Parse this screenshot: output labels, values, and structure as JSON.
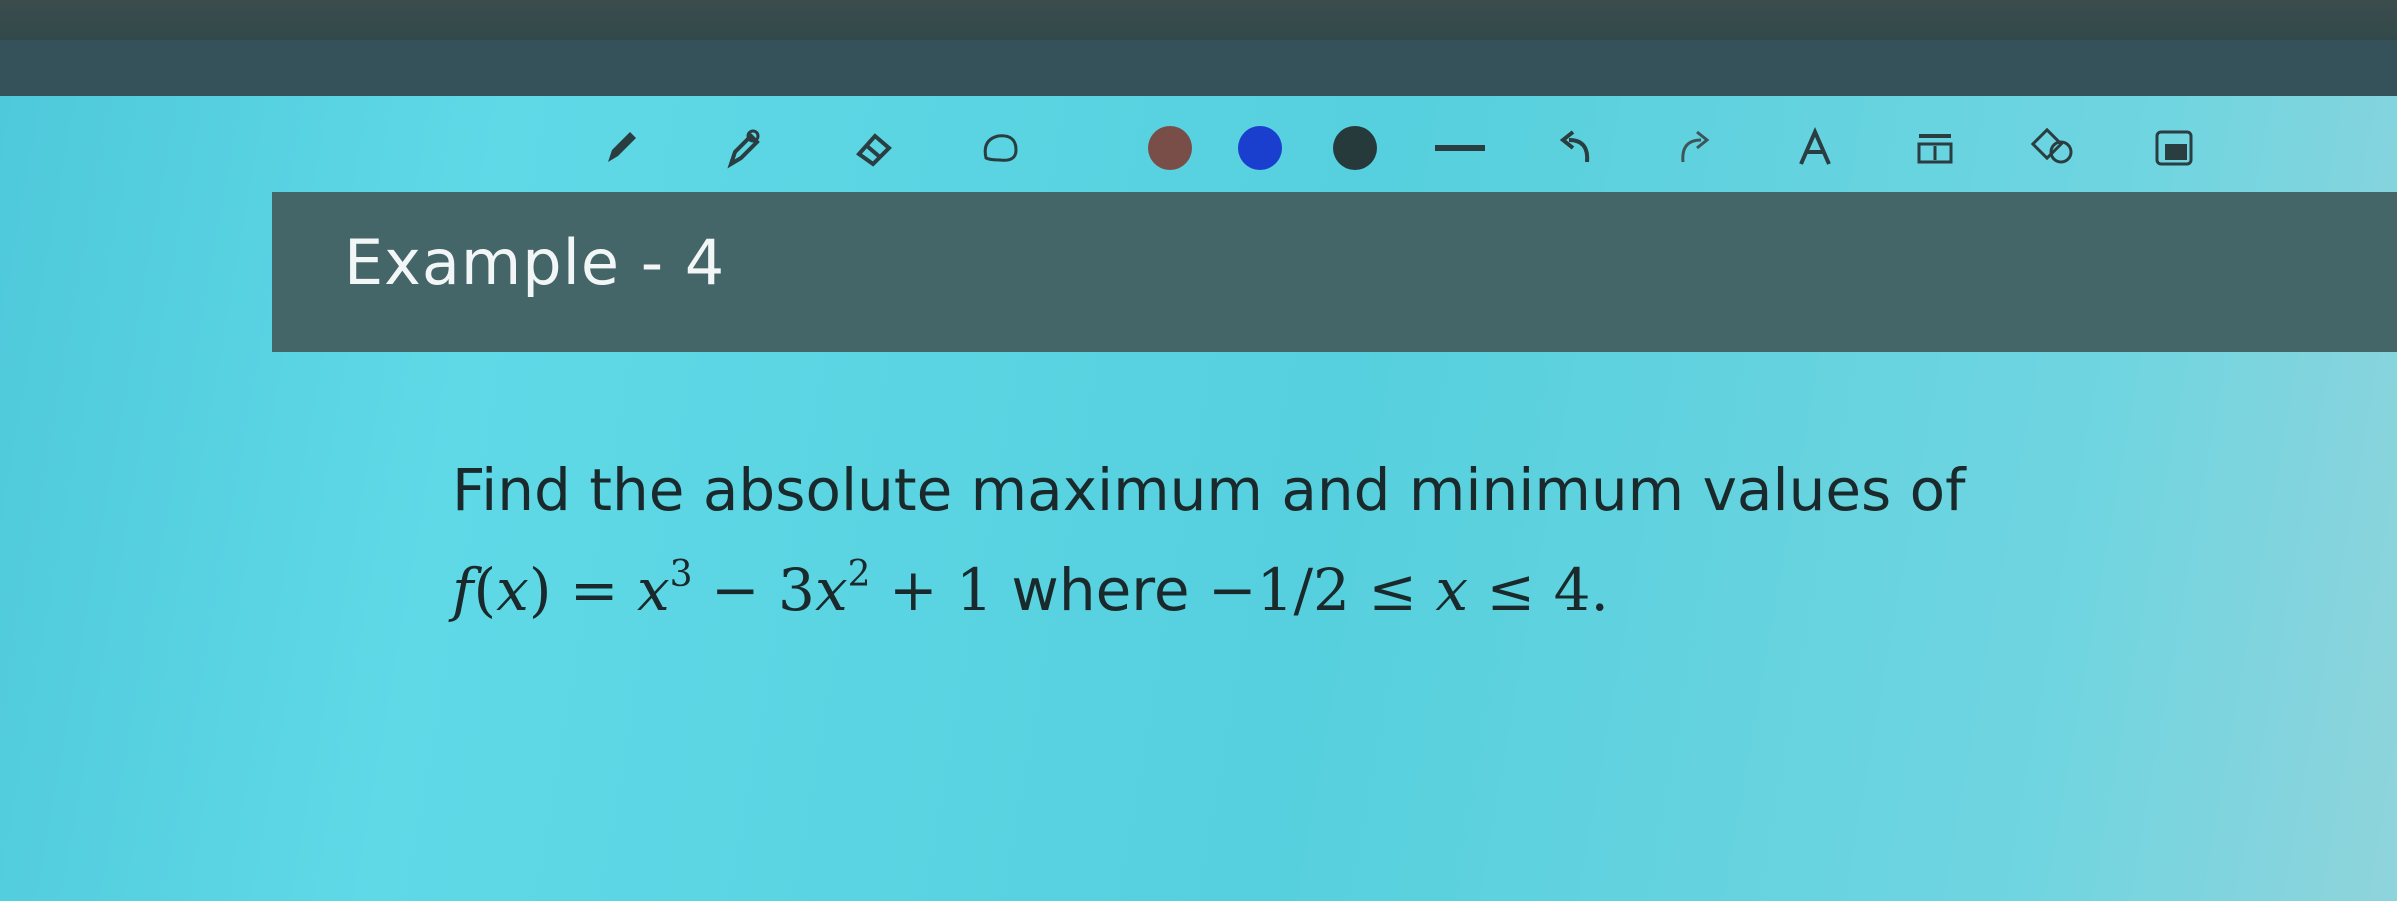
{
  "toolbar": {
    "tools": [
      "pencil-icon",
      "pen-icon",
      "eraser-icon",
      "lasso-icon",
      "color-brown",
      "color-blue",
      "color-black",
      "line-thickness-icon",
      "undo-icon",
      "redo-icon",
      "text-icon",
      "insert-icon",
      "shapes-icon",
      "image-icon"
    ],
    "colors": {
      "brown": "#7a4e48",
      "blue": "#1a3fcf",
      "black": "#263a3c"
    }
  },
  "header": {
    "title": "Example - 4"
  },
  "problem": {
    "line1": "Find the absolute maximum and minimum values of",
    "f_label": "f",
    "x_var": "x",
    "eq": " = ",
    "term1_exp": "3",
    "minus": " − 3",
    "term2_exp": "2",
    "plus": " + 1",
    "where": " where ",
    "range_low": "−1/2 ≤ ",
    "range_high": " ≤ 4."
  }
}
